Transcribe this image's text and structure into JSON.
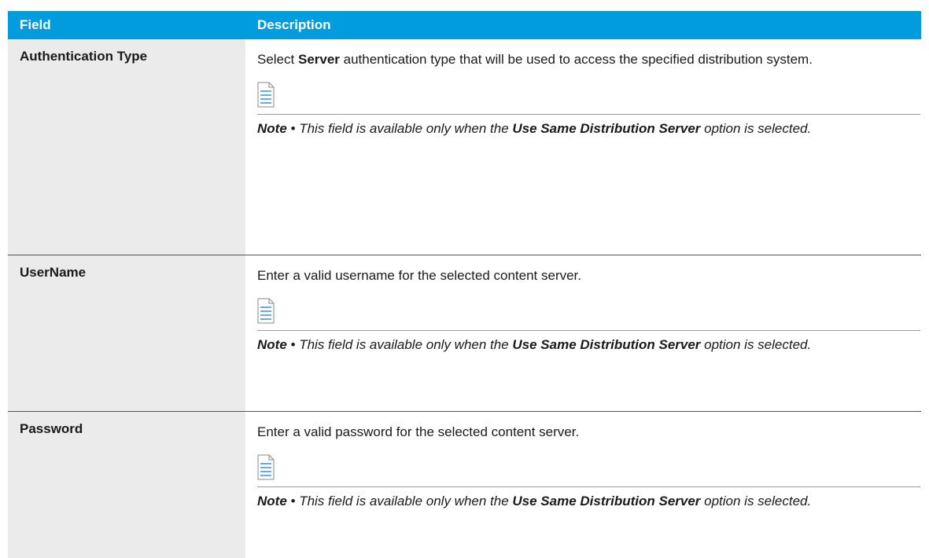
{
  "table": {
    "header": {
      "field": "Field",
      "description": "Description"
    },
    "rows": [
      {
        "field": "Authentication Type",
        "desc_pre": "Select ",
        "desc_bold": "Server",
        "desc_post": " authentication type that will be used to access the specified distribution system.",
        "note": {
          "label": "Note",
          "bullet": " • ",
          "pre": "This field is available only when the ",
          "bold": "Use Same Distribution Server",
          "post": " option is selected."
        }
      },
      {
        "field": "UserName",
        "desc": "Enter a valid username for the selected content server.",
        "note": {
          "label": "Note",
          "bullet": " • ",
          "pre": "This field is available only when the ",
          "bold": "Use Same Distribution Server",
          "post": " option is selected."
        }
      },
      {
        "field": "Password",
        "desc": "Enter a valid password for the selected content server.",
        "note": {
          "label": "Note",
          "bullet": " • ",
          "pre": "This field is available only when the ",
          "bold": "Use Same Distribution Server",
          "post": " option is selected."
        }
      }
    ]
  },
  "colors": {
    "header_bg": "#009cdd",
    "field_bg": "#ebebeb",
    "icon_line": "#3a8fd0"
  },
  "icons": {
    "note": "note-document-icon"
  }
}
